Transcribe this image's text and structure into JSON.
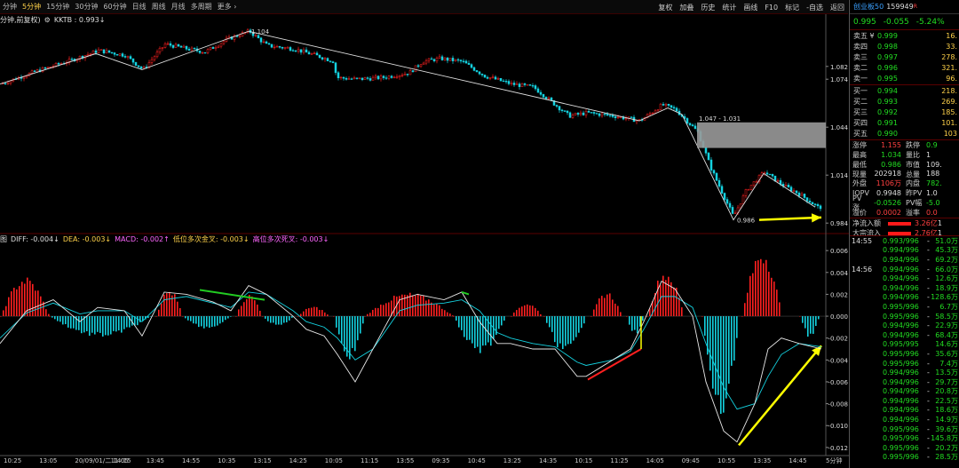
{
  "toolbar": {
    "items": [
      "分钟",
      "5分钟",
      "15分钟",
      "30分钟",
      "60分钟",
      "日线",
      "周线",
      "月线",
      "多周期",
      "更多 ›"
    ],
    "active_index": 1,
    "right_items": [
      "复权",
      "加叠",
      "历史",
      "统计",
      "画线",
      "F10",
      "标记",
      "-自选",
      "返回"
    ]
  },
  "main_legend": {
    "left": "分钟,前复权)",
    "kktb": "KKTB : 0.993↓"
  },
  "macd_legend": {
    "prefix": "图",
    "diff": "DIFF: -0.004↓",
    "dea": "DEA: -0.003↓",
    "macd": "MACD: -0.002↑",
    "golden": "低位多次金叉: -0.003↓",
    "dead": "高位多次死叉: -0.003↓"
  },
  "colors": {
    "up": "#ff2020",
    "down": "#14d2e0",
    "diff": "#e8e8e8",
    "dea": "#14d2e0",
    "annotation": "#ffff00",
    "green_line": "#22cc22",
    "grid": "#5a0000"
  },
  "price_axis": {
    "ticks": [
      "1.082",
      "1.074",
      "1.044",
      "1.014",
      "0.984"
    ]
  },
  "macd_axis": {
    "ticks": [
      "0.006",
      "0.004",
      "0.002",
      "0.000",
      "-0.002",
      "-0.004",
      "-0.006",
      "-0.008",
      "-0.010",
      "-0.012"
    ]
  },
  "annotations": {
    "high": "1.104",
    "low": "0.986",
    "box": "1.047 - 1.031"
  },
  "time_axis": [
    "10:25",
    "13:05",
    "20/09/01/二 14:15",
    "11:05",
    "13:45",
    "14:55",
    "10:35",
    "13:15",
    "14:25",
    "10:05",
    "11:15",
    "13:55",
    "09:35",
    "10:45",
    "13:25",
    "14:35",
    "10:15",
    "11:25",
    "14:05",
    "09:45",
    "10:55",
    "13:35",
    "14:45",
    "5分钟"
  ],
  "side": {
    "name": "创业板50",
    "code": "159949",
    "badge": "R",
    "price": "0.995",
    "change": "-0.055",
    "pct": "-5.24%",
    "sell": [
      {
        "label": "卖五 ¥",
        "price": "0.999",
        "vol": "16."
      },
      {
        "label": "卖四",
        "price": "0.998",
        "vol": "33."
      },
      {
        "label": "卖三",
        "price": "0.997",
        "vol": "278."
      },
      {
        "label": "卖二",
        "price": "0.996",
        "vol": "321."
      },
      {
        "label": "卖一",
        "price": "0.995",
        "vol": "96."
      }
    ],
    "buy": [
      {
        "label": "买一",
        "price": "0.994",
        "vol": "218."
      },
      {
        "label": "买二",
        "price": "0.993",
        "vol": "269."
      },
      {
        "label": "买三",
        "price": "0.992",
        "vol": "185."
      },
      {
        "label": "买四",
        "price": "0.991",
        "vol": "101."
      },
      {
        "label": "买五",
        "price": "0.990",
        "vol": "103"
      }
    ],
    "stats": [
      {
        "l1": "涨停",
        "v1": "1.155",
        "c1": "r",
        "l2": "跌停",
        "v2": "0.9",
        "c2": "g"
      },
      {
        "l1": "最高",
        "v1": "1.034",
        "c1": "g",
        "l2": "量比",
        "v2": "1",
        "c2": "w"
      },
      {
        "l1": "最低",
        "v1": "0.986",
        "c1": "g",
        "l2": "市值",
        "v2": "109.",
        "c2": "w"
      },
      {
        "l1": "现量",
        "v1": "202918",
        "c1": "w",
        "l2": "总量",
        "v2": "188",
        "c2": "w"
      },
      {
        "l1": "外盘",
        "v1": "1106万",
        "c1": "r",
        "l2": "内盘",
        "v2": "782.",
        "c2": "g"
      },
      {
        "l1": "IOPV",
        "v1": "0.9948",
        "c1": "w",
        "l2": "昨PV",
        "v2": "1.0",
        "c2": "w"
      },
      {
        "l1": "PV涨",
        "v1": "-0.0526",
        "c1": "g",
        "l2": "PV幅",
        "v2": "-5.0",
        "c2": "g"
      },
      {
        "l1": "溢价",
        "v1": "0.0002",
        "c1": "r",
        "l2": "溢率",
        "v2": "0.0",
        "c2": "r"
      }
    ],
    "flows": [
      {
        "label": "净流入额",
        "value": "3.26亿",
        "extra": "1"
      },
      {
        "label": "大宗流入",
        "value": "2.76亿",
        "extra": "1"
      }
    ],
    "tick_hours": [
      "14:55",
      "14:56"
    ],
    "ticks": [
      {
        "price": "0.993/996",
        "sep": "-",
        "vol": "51.0万"
      },
      {
        "price": "0.994/996",
        "sep": "-",
        "vol": "45.3万"
      },
      {
        "price": "0.994/996",
        "sep": "-",
        "vol": "69.2万"
      },
      {
        "price": "0.994/996",
        "sep": "-",
        "vol": "66.0万"
      },
      {
        "price": "0.994/996",
        "sep": "-",
        "vol": "12.6万"
      },
      {
        "price": "0.994/996",
        "sep": "-",
        "vol": "18.9万"
      },
      {
        "price": "0.994/996",
        "sep": "-",
        "vol": "128.6万"
      },
      {
        "price": "0.995/996",
        "sep": "-",
        "vol": "6.7万"
      },
      {
        "price": "0.995/996",
        "sep": "-",
        "vol": "58.5万"
      },
      {
        "price": "0.994/996",
        "sep": "-",
        "vol": "22.9万"
      },
      {
        "price": "0.994/996",
        "sep": "-",
        "vol": "68.4万"
      },
      {
        "price": "0.995/995",
        "sep": "",
        "vol": "14.6万"
      },
      {
        "price": "0.995/996",
        "sep": "-",
        "vol": "35.6万"
      },
      {
        "price": "0.995/996",
        "sep": "-",
        "vol": "7.4万"
      },
      {
        "price": "0.994/996",
        "sep": "-",
        "vol": "13.5万"
      },
      {
        "price": "0.994/996",
        "sep": "-",
        "vol": "29.7万"
      },
      {
        "price": "0.994/996",
        "sep": "-",
        "vol": "20.8万"
      },
      {
        "price": "0.994/996",
        "sep": "-",
        "vol": "22.5万"
      },
      {
        "price": "0.994/996",
        "sep": "-",
        "vol": "18.6万"
      },
      {
        "price": "0.994/996",
        "sep": "-",
        "vol": "14.9万"
      },
      {
        "price": "0.995/996",
        "sep": "-",
        "vol": "39.6万"
      },
      {
        "price": "0.995/996",
        "sep": "-",
        "vol": "145.8万"
      },
      {
        "price": "0.995/996",
        "sep": "-",
        "vol": "20.2万"
      },
      {
        "price": "0.995/996",
        "sep": "-",
        "vol": "28.5万"
      }
    ]
  },
  "chart_data": [
    {
      "type": "candlestick",
      "ylim": [
        0.978,
        1.108
      ],
      "price_path": [
        [
          0,
          1.071
        ],
        [
          40,
          1.079
        ],
        [
          80,
          1.086
        ],
        [
          110,
          1.092
        ],
        [
          140,
          1.089
        ],
        [
          160,
          1.08
        ],
        [
          185,
          1.096
        ],
        [
          210,
          1.093
        ],
        [
          230,
          1.091
        ],
        [
          255,
          1.099
        ],
        [
          280,
          1.104
        ],
        [
          300,
          1.095
        ],
        [
          330,
          1.093
        ],
        [
          360,
          1.088
        ],
        [
          375,
          1.085
        ],
        [
          378,
          1.075
        ],
        [
          400,
          1.074
        ],
        [
          430,
          1.075
        ],
        [
          460,
          1.078
        ],
        [
          475,
          1.085
        ],
        [
          495,
          1.087
        ],
        [
          520,
          1.085
        ],
        [
          545,
          1.076
        ],
        [
          575,
          1.071
        ],
        [
          600,
          1.069
        ],
        [
          620,
          1.06
        ],
        [
          640,
          1.051
        ],
        [
          660,
          1.053
        ],
        [
          690,
          1.051
        ],
        [
          720,
          1.048
        ],
        [
          745,
          1.058
        ],
        [
          760,
          1.055
        ],
        [
          785,
          1.041
        ],
        [
          800,
          1.018
        ],
        [
          825,
          0.988
        ],
        [
          840,
          1.005
        ],
        [
          860,
          1.016
        ],
        [
          880,
          1.008
        ],
        [
          900,
          1.002
        ],
        [
          920,
          0.994
        ]
      ],
      "zigzag": [
        [
          0,
          1.071
        ],
        [
          108,
          1.09
        ],
        [
          160,
          1.08
        ],
        [
          280,
          1.104
        ],
        [
          720,
          1.048
        ],
        [
          752,
          1.056
        ],
        [
          768,
          1.052
        ],
        [
          826,
          0.986
        ],
        [
          860,
          1.015
        ],
        [
          918,
          0.994
        ]
      ],
      "box": {
        "x0": 785,
        "x1": 930,
        "y0": 1.047,
        "y1": 1.031
      }
    },
    {
      "type": "bar",
      "series": [
        {
          "name": "MACD",
          "values": [
            {
              "from": 0,
              "to": 55,
              "peak": 0.0032,
              "shape": 1
            },
            {
              "from": 55,
              "to": 170,
              "peak": -0.0017,
              "shape": 1
            },
            {
              "from": 175,
              "to": 205,
              "peak": 0.0022,
              "shape": 1
            },
            {
              "from": 205,
              "to": 260,
              "peak": -0.001,
              "shape": 1
            },
            {
              "from": 265,
              "to": 295,
              "peak": 0.0018,
              "shape": 1
            },
            {
              "from": 295,
              "to": 330,
              "peak": -0.0008,
              "shape": 1
            },
            {
              "from": 335,
              "to": 370,
              "peak": 0.0008,
              "shape": 1
            },
            {
              "from": 375,
              "to": 410,
              "peak": -0.0035,
              "shape": 1
            },
            {
              "from": 410,
              "to": 510,
              "peak": 0.0019,
              "shape": 1
            },
            {
              "from": 510,
              "to": 570,
              "peak": -0.003,
              "shape": 1
            },
            {
              "from": 575,
              "to": 610,
              "peak": 0.0011,
              "shape": 1
            },
            {
              "from": 612,
              "to": 660,
              "peak": -0.003,
              "shape": 1
            },
            {
              "from": 665,
              "to": 700,
              "peak": 0.002,
              "shape": 1
            },
            {
              "from": 705,
              "to": 725,
              "peak": -0.0015,
              "shape": 1
            },
            {
              "from": 728,
              "to": 770,
              "peak": 0.0037,
              "shape": 1
            },
            {
              "from": 790,
              "to": 832,
              "peak": -0.0085,
              "shape": 1
            },
            {
              "from": 835,
              "to": 880,
              "peak": 0.0055,
              "shape": 1
            },
            {
              "from": 900,
              "to": 922,
              "peak": -0.0017,
              "shape": 1
            }
          ]
        },
        {
          "name": "DIFF",
          "line": [
            [
              0,
              -0.0025
            ],
            [
              30,
              0.0005
            ],
            [
              60,
              0.0015
            ],
            [
              90,
              -0.0005
            ],
            [
              110,
              0.0008
            ],
            [
              140,
              0.0005
            ],
            [
              160,
              -0.0018
            ],
            [
              185,
              0.0022
            ],
            [
              210,
              0.002
            ],
            [
              240,
              0.0013
            ],
            [
              260,
              0.0005
            ],
            [
              280,
              0.0028
            ],
            [
              300,
              0.002
            ],
            [
              330,
              0.0
            ],
            [
              345,
              -0.0012
            ],
            [
              365,
              -0.0018
            ],
            [
              380,
              -0.0035
            ],
            [
              400,
              -0.006
            ],
            [
              420,
              -0.003
            ],
            [
              450,
              0.0015
            ],
            [
              470,
              0.002
            ],
            [
              500,
              0.0015
            ],
            [
              520,
              0.0022
            ],
            [
              540,
              -0.0005
            ],
            [
              560,
              -0.0025
            ],
            [
              575,
              -0.0025
            ],
            [
              600,
              -0.003
            ],
            [
              625,
              -0.003
            ],
            [
              650,
              -0.0055
            ],
            [
              660,
              -0.0055
            ],
            [
              690,
              -0.004
            ],
            [
              710,
              -0.003
            ],
            [
              725,
              -0.0005
            ],
            [
              745,
              0.0032
            ],
            [
              760,
              0.0025
            ],
            [
              780,
              0.0
            ],
            [
              795,
              -0.006
            ],
            [
              815,
              -0.0105
            ],
            [
              830,
              -0.0115
            ],
            [
              850,
              -0.008
            ],
            [
              865,
              -0.003
            ],
            [
              880,
              -0.002
            ],
            [
              900,
              -0.0025
            ],
            [
              925,
              -0.003
            ]
          ]
        },
        {
          "name": "DEA",
          "line": [
            [
              0,
              -0.002
            ],
            [
              30,
              0.0003
            ],
            [
              60,
              0.0012
            ],
            [
              90,
              0.0002
            ],
            [
              110,
              0.0005
            ],
            [
              140,
              0.0005
            ],
            [
              160,
              -0.0005
            ],
            [
              185,
              0.0015
            ],
            [
              210,
              0.0018
            ],
            [
              240,
              0.0012
            ],
            [
              260,
              0.0008
            ],
            [
              280,
              0.0022
            ],
            [
              300,
              0.002
            ],
            [
              330,
              0.0005
            ],
            [
              345,
              -0.0005
            ],
            [
              365,
              -0.001
            ],
            [
              380,
              -0.002
            ],
            [
              400,
              -0.004
            ],
            [
              420,
              -0.003
            ],
            [
              450,
              0.0005
            ],
            [
              470,
              0.001
            ],
            [
              500,
              0.0012
            ],
            [
              520,
              0.0015
            ],
            [
              540,
              0.0005
            ],
            [
              560,
              -0.0015
            ],
            [
              575,
              -0.002
            ],
            [
              600,
              -0.0025
            ],
            [
              625,
              -0.0028
            ],
            [
              650,
              -0.0042
            ],
            [
              660,
              -0.0045
            ],
            [
              690,
              -0.004
            ],
            [
              710,
              -0.0032
            ],
            [
              725,
              -0.0012
            ],
            [
              745,
              0.0018
            ],
            [
              760,
              0.0018
            ],
            [
              780,
              0.0008
            ],
            [
              795,
              -0.0025
            ],
            [
              815,
              -0.0065
            ],
            [
              830,
              -0.0085
            ],
            [
              850,
              -0.008
            ],
            [
              865,
              -0.0055
            ],
            [
              880,
              -0.0035
            ],
            [
              900,
              -0.0025
            ],
            [
              925,
              -0.0028
            ]
          ]
        }
      ],
      "ylim": [
        -0.0125,
        0.0065
      ]
    }
  ]
}
